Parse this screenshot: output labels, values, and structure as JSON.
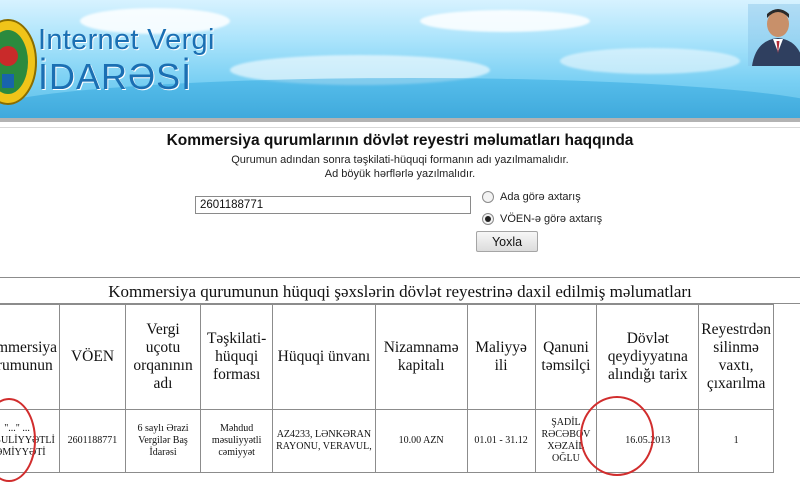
{
  "header": {
    "logo_line1": "Internet Vergi",
    "logo_line2": "İDARƏSİ"
  },
  "page": {
    "heading": "Kommersiya qurumlarının dövlət reyestri məlumatları haqqında",
    "note1": "Qurumun adından sonra təşkilati-hüquqi formanın adı yazılmamalıdır.",
    "note2": "Ad böyük hərflərlə yazılmalıdır."
  },
  "search": {
    "value": "2601188771",
    "options": [
      {
        "label": "Ada görə axtarış",
        "selected": false
      },
      {
        "label": "VÖEN-ə görə axtarış",
        "selected": true
      }
    ],
    "button": "Yoxla"
  },
  "table": {
    "title": "Kommersiya qurumunun hüquqi şəxslərin dövlət reyestrinə daxil edilmiş məlumatları",
    "headers": [
      "Kommersiya qurumunun",
      "VÖEN",
      "Vergi uçotu orqanının adı",
      "Təşkilati-hüquqi forması",
      "Hüquqi ünvanı",
      "Nizamnamə kapitalı",
      "Maliyyə ili",
      "Qanuni təmsilçi",
      "Dövlət qeydiyyatına alındığı tarix",
      "Reyestrdən silinmə vaxtı, çıxarılma"
    ],
    "row": [
      "\"...\" ... MƏSULİYYƏTLİ CƏMİYYƏTİ",
      "2601188771",
      "6 saylı Ərazi Vergilər Baş İdarəsi",
      "Məhdud məsuliyyətli cəmiyyət",
      "AZ4233, LƏNKƏRAN RAYONU, VERAVUL,",
      "10.00 AZN",
      "01.01 - 31.12",
      "ŞADİL RƏCƏBOV XƏZAİL OĞLU",
      "16.05.2013",
      "1"
    ]
  },
  "colors": {
    "logo_blue": "#1b6fb3",
    "annotation_red": "#d12d2d"
  }
}
